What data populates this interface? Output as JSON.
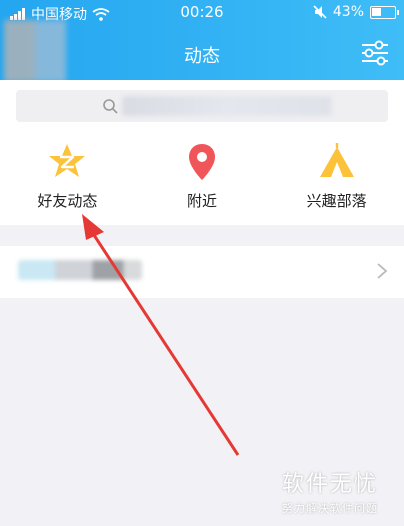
{
  "status_bar": {
    "carrier": "中国移动",
    "time": "00:26",
    "battery": "43%"
  },
  "header": {
    "title": "动态"
  },
  "shortcuts": [
    {
      "label": "好友动态",
      "icon": "qzone-star-icon"
    },
    {
      "label": "附近",
      "icon": "location-pin-icon"
    },
    {
      "label": "兴趣部落",
      "icon": "tent-icon"
    }
  ],
  "watermark": {
    "title": "软件无忧",
    "subtitle": "努力解决软件问题"
  },
  "colors": {
    "header_start": "#24a6f0",
    "header_end": "#3fbdf7",
    "arrow": "#e53935",
    "star": "#fbc23a",
    "pin": "#f0555a",
    "tent": "#fbc23a"
  }
}
